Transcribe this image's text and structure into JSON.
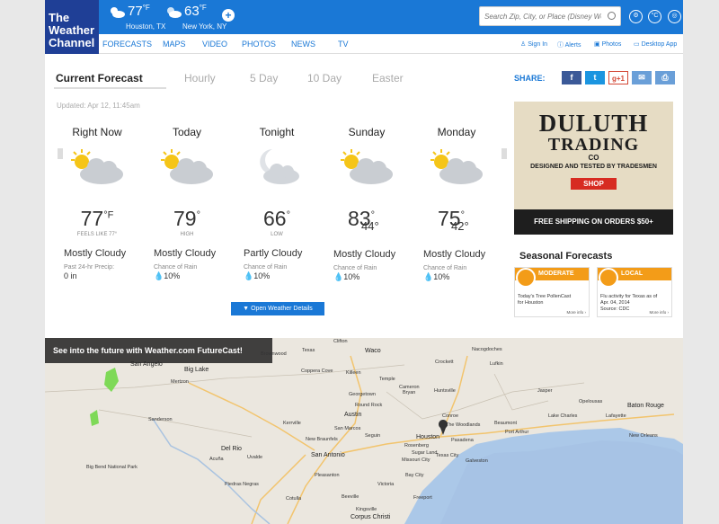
{
  "header": {
    "logo_lines": [
      "The",
      "Weather",
      "Channel"
    ],
    "cities": [
      {
        "name": "Houston, TX",
        "temp": "77",
        "unit": "°F",
        "icon": "partly-cloudy-icon"
      },
      {
        "name": "New York, NY",
        "temp": "63",
        "unit": "°F",
        "icon": "partly-cloudy-icon"
      }
    ],
    "search_placeholder": "Search Zip, City, or Place (Disney World)"
  },
  "nav": {
    "items": [
      "FORECASTS",
      "MAPS",
      "VIDEO",
      "PHOTOS",
      "NEWS",
      "TV"
    ],
    "utility": [
      "Sign In",
      "Alerts",
      "Photos",
      "Desktop App"
    ]
  },
  "tabs": [
    "Current Forecast",
    "Hourly",
    "5 Day",
    "10 Day",
    "Easter"
  ],
  "updated": "Updated: Apr 12, 11:45am",
  "share": {
    "label": "SHARE:",
    "buttons": [
      "f",
      "t",
      "g+1",
      "✉",
      "⎙"
    ]
  },
  "forecast": [
    {
      "day": "Right Now",
      "icon": "partly-cloudy-icon",
      "temp": "77",
      "unit": "°F",
      "sub": "FEELS LIKE 77°",
      "low": "",
      "cond": "Mostly Cloudy",
      "meta_label": "Past 24-hr Precip:",
      "meta_value": "0 in"
    },
    {
      "day": "Today",
      "icon": "partly-cloudy-icon",
      "temp": "79",
      "unit": "°",
      "sub": "HIGH",
      "low": "",
      "cond": "Mostly Cloudy",
      "meta_label": "Chance of Rain",
      "meta_value": "10%"
    },
    {
      "day": "Tonight",
      "icon": "night-cloudy-icon",
      "temp": "66",
      "unit": "°",
      "sub": "LOW",
      "low": "",
      "cond": "Partly Cloudy",
      "meta_label": "Chance of Rain",
      "meta_value": "10%"
    },
    {
      "day": "Sunday",
      "icon": "partly-cloudy-icon",
      "temp": "83",
      "unit": "°",
      "sub": "",
      "low": "44°",
      "cond": "Mostly Cloudy",
      "meta_label": "Chance of Rain",
      "meta_value": "10%"
    },
    {
      "day": "Monday",
      "icon": "partly-cloudy-icon",
      "temp": "75",
      "unit": "°",
      "sub": "",
      "low": "42°",
      "cond": "Mostly Cloudy",
      "meta_label": "Chance of Rain",
      "meta_value": "10%"
    }
  ],
  "open_details": "Open Weather Details",
  "ad": {
    "brand": "DULUTH",
    "sub_brand": "TRADING",
    "co": "CO",
    "tagline": "DESIGNED AND TESTED BY TRADESMEN",
    "button": "SHOP",
    "footer": "FREE SHIPPING ON ORDERS $50+"
  },
  "seasonal": {
    "title": "Seasonal Forecasts",
    "cards": [
      {
        "label": "MODERATE",
        "line1": "Today's Tree PollenCast",
        "line2": "for Houston",
        "more": "More info ›"
      },
      {
        "label": "LOCAL",
        "line1": "Flu activity for Texas as of",
        "line2": "Apr. 04, 2014",
        "source": "Source: CDC",
        "more": "More info ›"
      }
    ]
  },
  "map": {
    "banner": "See into the future with Weather.com FutureCast!",
    "labels": [
      "Texas",
      "Clifton",
      "Waco",
      "Brownwood",
      "Big Lake",
      "Mertzon",
      "San Angelo",
      "Coppera Cove",
      "Killeen",
      "Temple",
      "Cameron",
      "Bryan",
      "Huntsville",
      "Georgetown",
      "Round Rock",
      "Austin",
      "San Marcos",
      "New Braunfels",
      "San Antonio",
      "Kerrville",
      "Houston",
      "Pasadena",
      "Texas City",
      "Galveston",
      "Bay City",
      "Victoria",
      "Beaumont",
      "Port Arthur",
      "Lake Charles",
      "Lafayette",
      "Baton Rouge",
      "Nacogdoches",
      "Lufkin",
      "The Woodlands",
      "Conroe",
      "Freeport",
      "Corpus Christi",
      "Sanderson",
      "Del Rio",
      "Uvalde",
      "Acuña",
      "Piedras Negras",
      "Big Bend National Park",
      "Cotulla",
      "Beeville",
      "Pleasanton",
      "Sugar Land",
      "Missouri City",
      "Seguin",
      "Kingsville",
      "Rosenberg",
      "New Orleans",
      "Opelousas",
      "Crockett",
      "Jasper"
    ]
  }
}
